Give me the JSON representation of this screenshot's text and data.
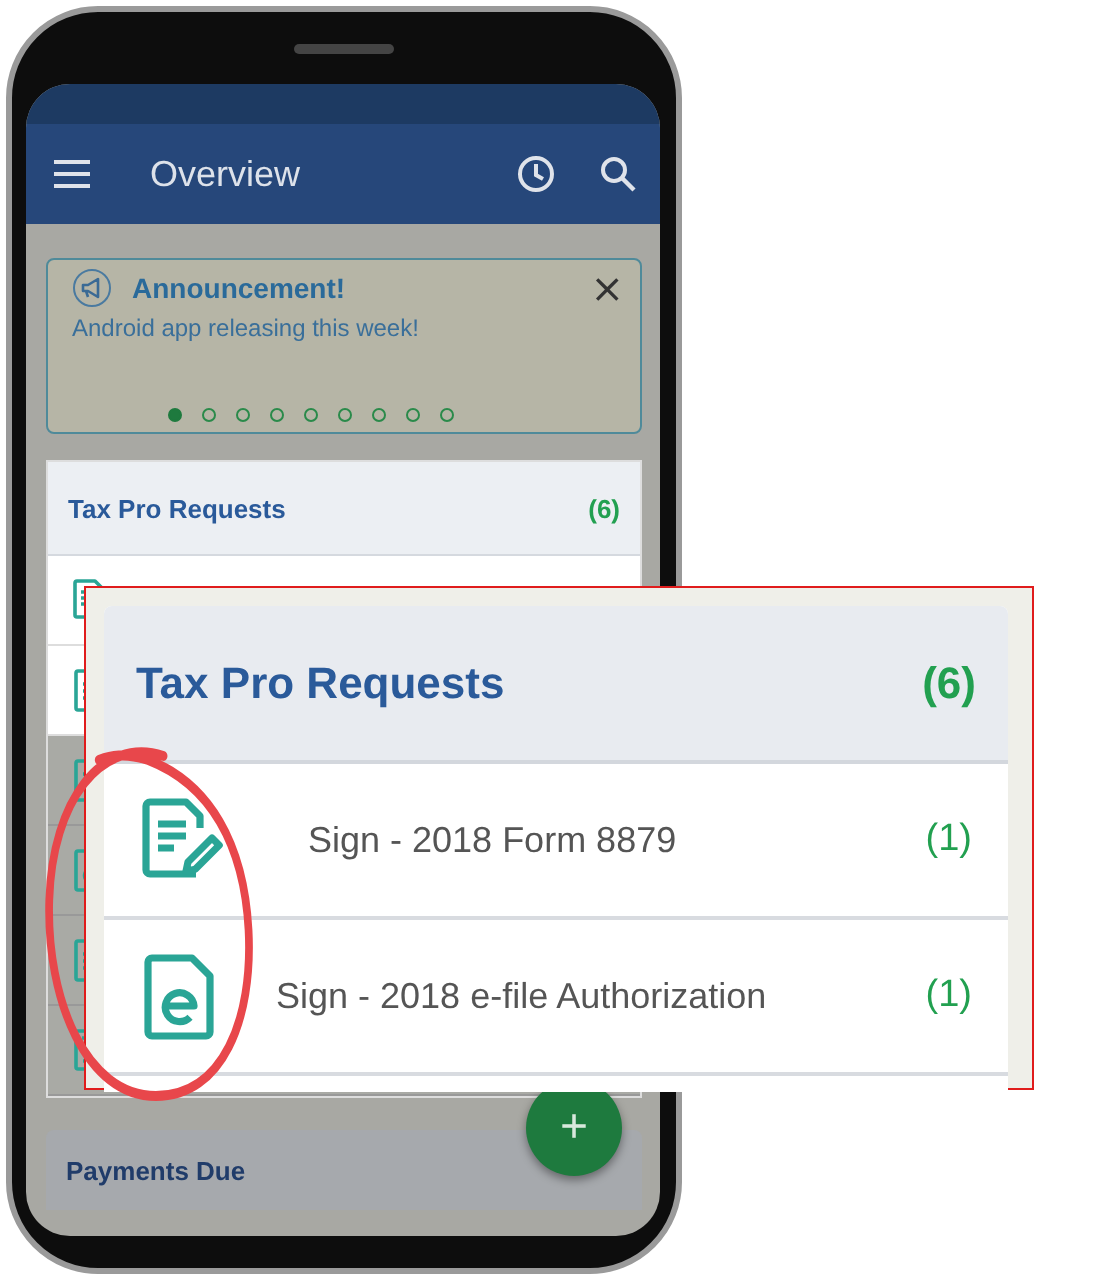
{
  "app_bar": {
    "title": "Overview"
  },
  "announcement": {
    "title": "Announcement!",
    "message": "Android app releasing this week!",
    "close": "×",
    "dots": [
      {
        "selected": true
      },
      {
        "selected": false
      },
      {
        "selected": false
      },
      {
        "selected": false
      },
      {
        "selected": false
      },
      {
        "selected": false
      },
      {
        "selected": false
      },
      {
        "selected": false
      },
      {
        "selected": false
      }
    ]
  },
  "requests_card": {
    "title": "Tax Pro Requests",
    "count": "(6)",
    "rows": [
      {
        "kind": "sign",
        "dimmed": false
      },
      {
        "kind": "doc",
        "dimmed": false
      },
      {
        "kind": "doc",
        "dimmed": true
      },
      {
        "kind": "efile",
        "dimmed": true
      },
      {
        "kind": "doc",
        "dimmed": true
      },
      {
        "kind": "calc",
        "dimmed": true
      }
    ]
  },
  "payments_card": {
    "title": "Payments Due"
  },
  "fab": {
    "label": "+"
  },
  "callout": {
    "title": "Tax Pro Requests",
    "count": "(6)",
    "rows": [
      {
        "kind": "sign",
        "label": "Sign - 2018 Form 8879",
        "count": "(1)"
      },
      {
        "kind": "efile",
        "label": "Sign - 2018 e-file Authorization",
        "count": "(1)"
      }
    ]
  }
}
